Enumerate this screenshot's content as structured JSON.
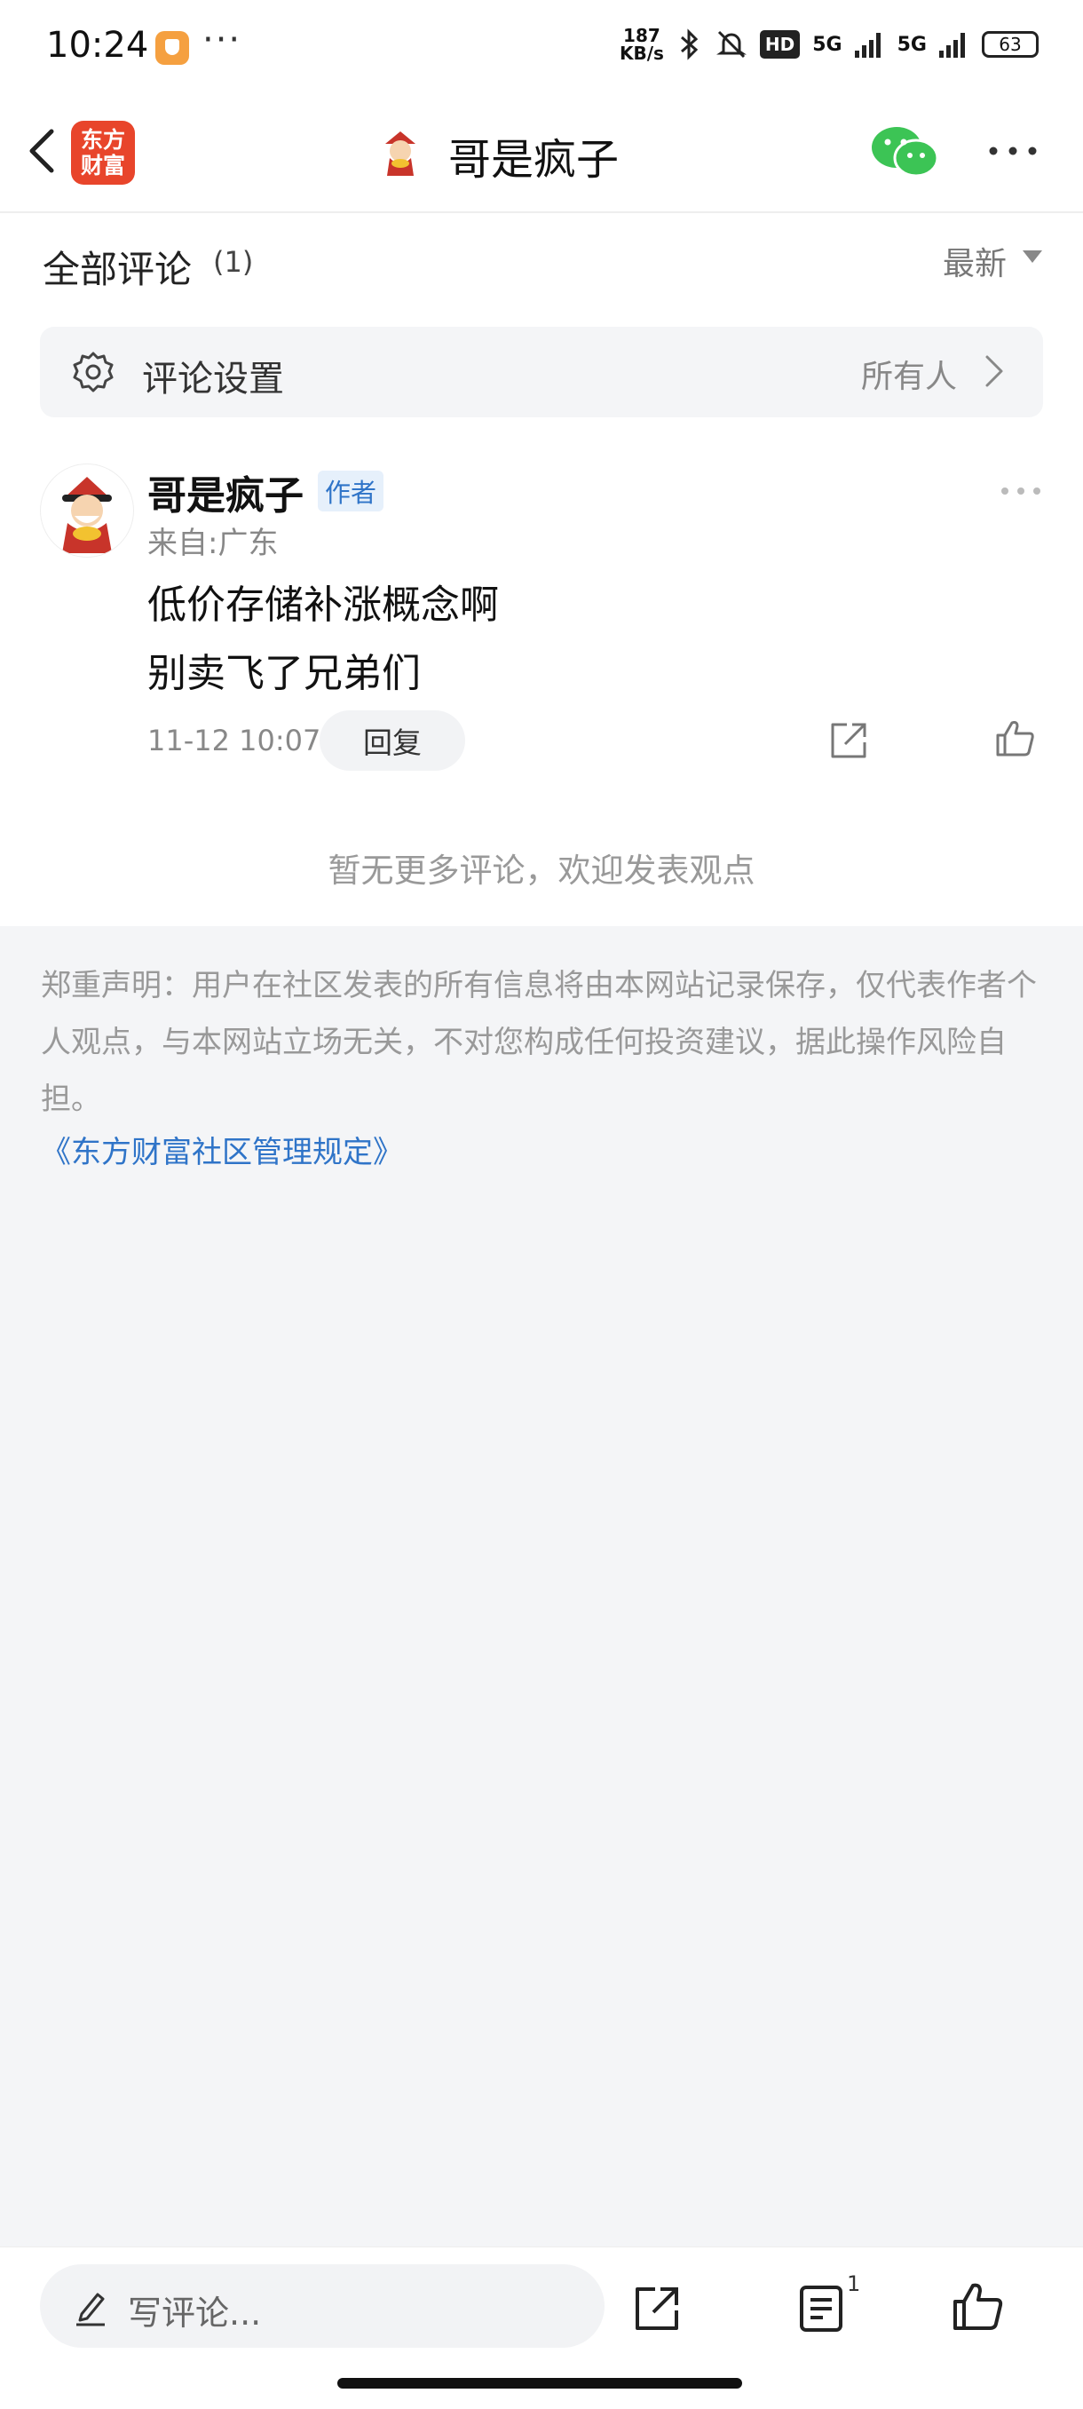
{
  "status_bar": {
    "time": "10:24",
    "dots": "···",
    "net_speed_top": "187",
    "net_speed_bottom": "KB/s",
    "hd_label": "HD",
    "signal1_label": "5G",
    "signal2_label": "5G",
    "battery": "63"
  },
  "header": {
    "logo_line1": "东方",
    "logo_line2": "财富",
    "title": "哥是疯子"
  },
  "comments_header": {
    "title": "全部评论",
    "count": "(1)",
    "sort_label": "最新"
  },
  "settings": {
    "label": "评论设置",
    "value": "所有人"
  },
  "comment": {
    "author": "哥是疯子",
    "badge": "作者",
    "location": "来自:广东",
    "line1": "低价存储补涨概念啊",
    "line2": "别卖飞了兄弟们",
    "time": "11-12 10:07",
    "reply_label": "回复"
  },
  "no_more_text": "暂无更多评论，欢迎发表观点",
  "disclaimer": "郑重声明：用户在社区发表的所有信息将由本网站记录保存，仅代表作者个人观点，与本网站立场无关，不对您构成任何投资建议，据此操作风险自担。",
  "rules_link": "《东方财富社区管理规定》",
  "bottom_bar": {
    "placeholder": "写评论...",
    "list_count": "1"
  },
  "colors": {
    "brand_red": "#e8452b",
    "link_blue": "#2f74c8",
    "wechat_green": "#3cc455"
  },
  "icons": [
    "back-icon",
    "wechat-icon",
    "more-icon",
    "gear-icon",
    "chevron-right-icon",
    "share-icon",
    "like-icon",
    "pen-icon",
    "list-icon"
  ]
}
